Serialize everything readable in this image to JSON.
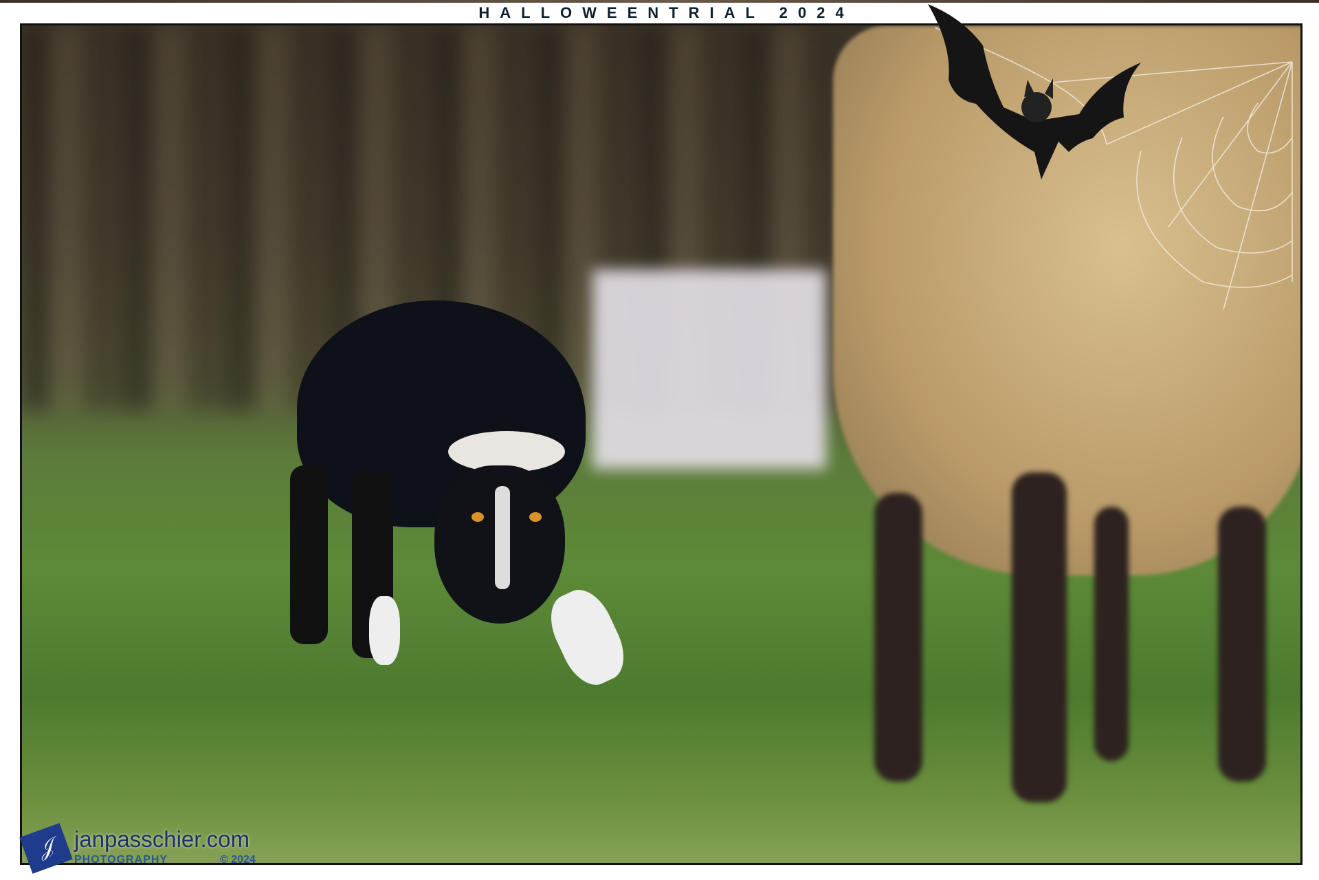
{
  "banner": {
    "title": "HALLOWEENTRIAL 2024"
  },
  "watermark": {
    "logo_text": "Jan",
    "site": "janpasschier.com",
    "subtitle": "PHOTOGRAPHY",
    "copyright": "© 2024"
  },
  "colors": {
    "title": "#10202e",
    "watermark_blue": "#1e3b8c",
    "grass": "#5d8a38",
    "wool": "#d9c08f"
  }
}
